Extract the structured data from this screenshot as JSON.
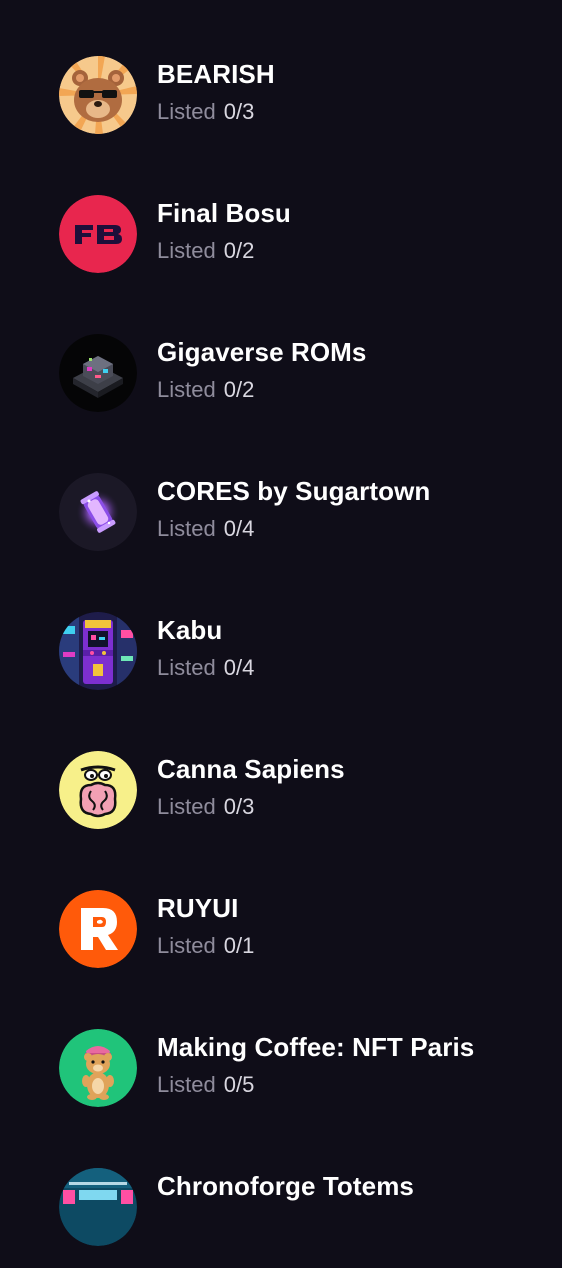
{
  "listed_label": "Listed",
  "collections": [
    {
      "name": "BEARISH",
      "listed": "0/3",
      "icon": "bear-sunglasses-icon"
    },
    {
      "name": "Final Bosu",
      "listed": "0/2",
      "icon": "fb-logo-icon"
    },
    {
      "name": "Gigaverse ROMs",
      "listed": "0/2",
      "icon": "rom-cartridge-icon"
    },
    {
      "name": "CORES by Sugartown",
      "listed": "0/4",
      "icon": "glowing-core-icon"
    },
    {
      "name": "Kabu",
      "listed": "0/4",
      "icon": "arcade-machine-icon"
    },
    {
      "name": "Canna Sapiens",
      "listed": "0/3",
      "icon": "brain-character-icon"
    },
    {
      "name": "RUYUI",
      "listed": "0/1",
      "icon": "ruyui-r-logo-icon"
    },
    {
      "name": "Making Coffee: NFT Paris",
      "listed": "0/5",
      "icon": "teddy-bear-icon"
    },
    {
      "name": "Chronoforge Totems",
      "listed": "",
      "icon": "chronoforge-logo-icon"
    }
  ],
  "colors": {
    "background": "#0f0d18",
    "title": "#ffffff",
    "label": "#8f8c9c",
    "count": "#d9d7e0"
  }
}
